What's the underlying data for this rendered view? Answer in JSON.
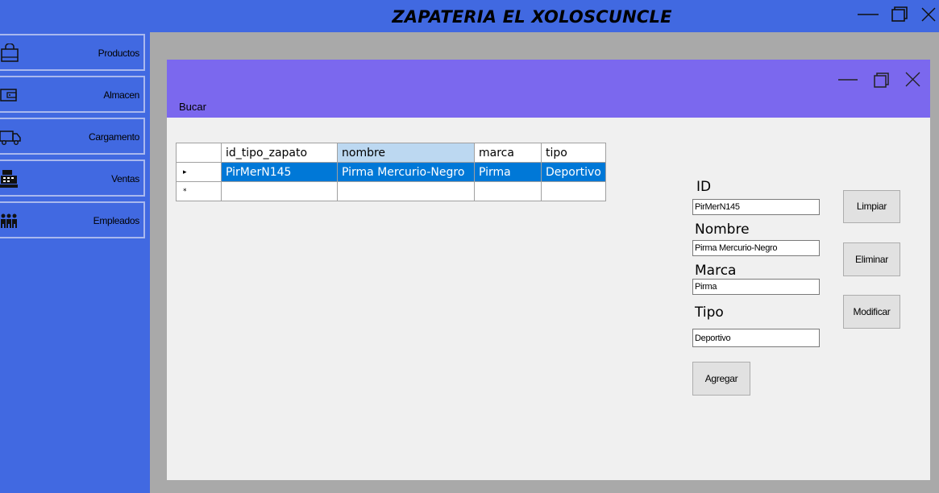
{
  "app": {
    "title": "ZAPATERIA EL XOLOSCUNCLE"
  },
  "sidebar": {
    "items": [
      {
        "label": "Productos",
        "icon": "shopping-bag-icon"
      },
      {
        "label": "Almacen",
        "icon": "wallet-icon"
      },
      {
        "label": "Cargamento",
        "icon": "truck-icon"
      },
      {
        "label": "Ventas",
        "icon": "cash-register-icon"
      },
      {
        "label": "Empleados",
        "icon": "people-icon"
      }
    ]
  },
  "child": {
    "menu_search": "Bucar"
  },
  "table": {
    "columns": [
      "id_tipo_zapato",
      "nombre",
      "marca",
      "tipo"
    ],
    "rows": [
      [
        "PirMerN145",
        "Pirma Mercurio-Negro",
        "Pirma",
        "Deportivo"
      ]
    ],
    "selected_marker": "▸",
    "new_row_marker": "*"
  },
  "form": {
    "id_label": "ID",
    "id_value": "PirMerN145",
    "nombre_label": "Nombre",
    "nombre_value": "Pirma Mercurio-Negro",
    "marca_label": "Marca",
    "marca_value": "Pirma",
    "tipo_label": "Tipo",
    "tipo_value": "Deportivo"
  },
  "buttons": {
    "limpiar": "Limpiar",
    "eliminar": "Eliminar",
    "modificar": "Modificar",
    "agregar": "Agregar"
  },
  "colors": {
    "titlebar": "#4169e1",
    "child_header": "#7b68ee",
    "selection": "#0078d7",
    "mdi_bg": "#a9a9a9"
  }
}
